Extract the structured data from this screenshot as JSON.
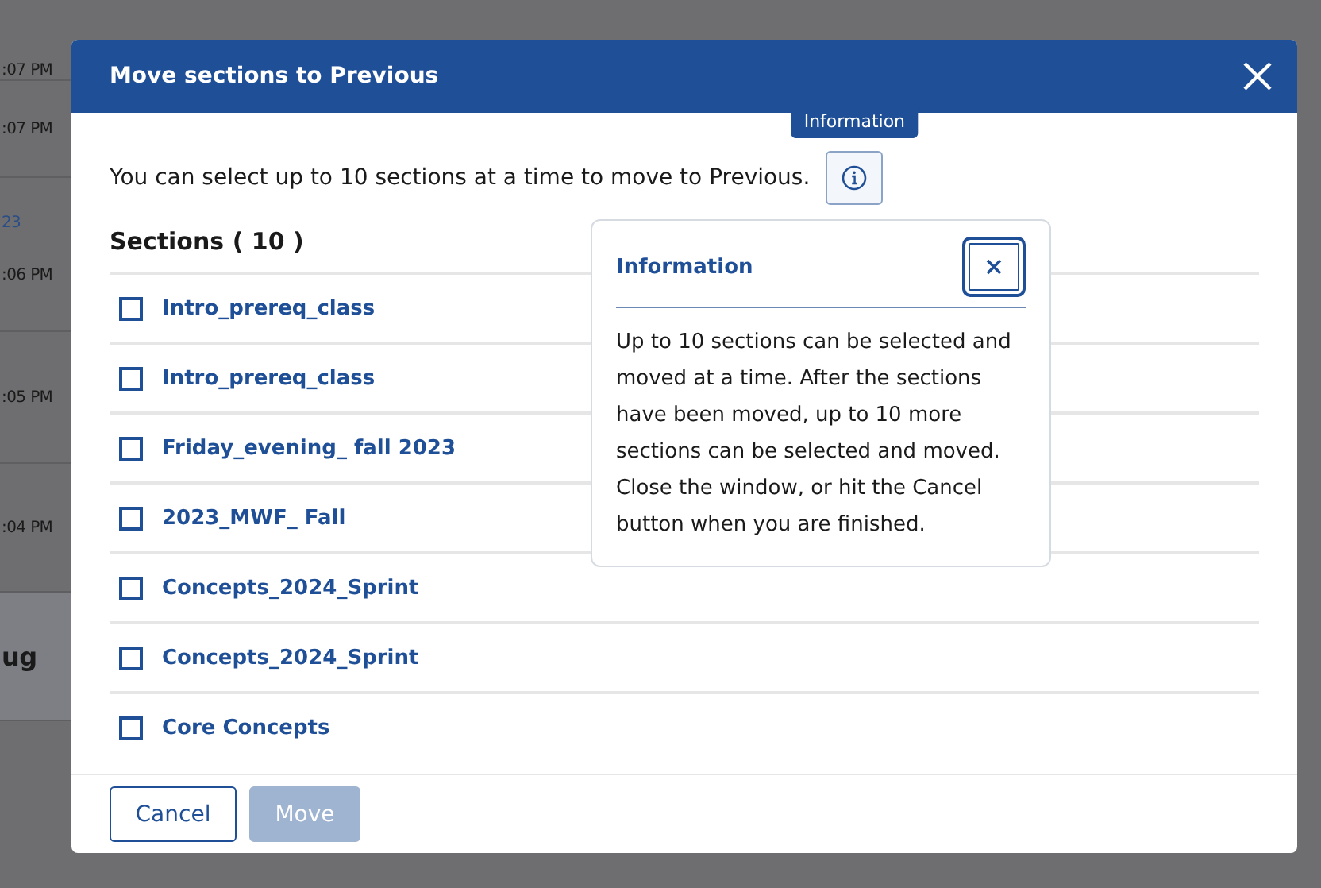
{
  "background": {
    "times": [
      ":07 PM",
      ":07 PM",
      "23",
      ":06 PM",
      ":05 PM",
      ":04 PM",
      "ug"
    ]
  },
  "dialog": {
    "title": "Move sections to Previous",
    "intro": "You can select up to 10 sections at a time to move to Previous.",
    "tooltip": "Information",
    "heading": "Sections ( 10 )",
    "sections": [
      {
        "name": "Intro_prereq_class",
        "checked": false
      },
      {
        "name": "Intro_prereq_class",
        "checked": false
      },
      {
        "name": "Friday_evening_ fall 2023",
        "checked": false
      },
      {
        "name": "2023_MWF_ Fall",
        "checked": false
      },
      {
        "name": "Concepts_2024_Sprint",
        "checked": false
      },
      {
        "name": "Concepts_2024_Sprint",
        "checked": false
      },
      {
        "name": "Core Concepts",
        "checked": false
      }
    ],
    "popover": {
      "title": "Information",
      "body": "Up to 10 sections can be selected and moved at a time. After the sections have been moved, up to 10 more sections can be selected and moved. Close the window, or hit the Cancel button when you are finished."
    },
    "buttons": [
      {
        "label": "Cancel",
        "disabled": false
      },
      {
        "label": "Move",
        "disabled": true
      }
    ]
  }
}
